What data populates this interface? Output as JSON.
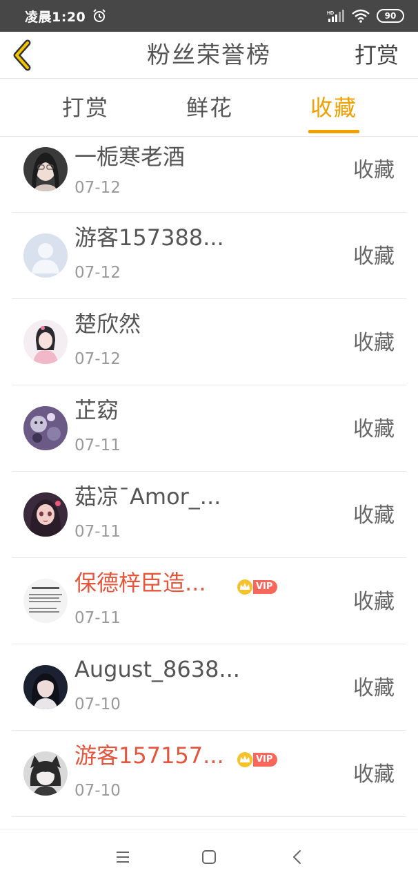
{
  "status_bar": {
    "time": "凌晨1:20",
    "battery": "90",
    "icons": [
      "alarm-icon",
      "hd-signal-icon",
      "wifi-icon",
      "battery-icon"
    ]
  },
  "header": {
    "back_icon": "chevron-left-icon",
    "title": "粉丝荣誉榜",
    "action": "打赏"
  },
  "tabs": [
    {
      "label": "打赏",
      "active": false
    },
    {
      "label": "鲜花",
      "active": false
    },
    {
      "label": "收藏",
      "active": true
    }
  ],
  "colors": {
    "accent": "#f0a000",
    "vip_name": "#e4553b",
    "vip_badge": "#f8675a",
    "status_bar": "#474747"
  },
  "fans": [
    {
      "name": "一栀寒老酒",
      "date": "07-12",
      "action": "收藏",
      "vip": false
    },
    {
      "name": "游客157388...",
      "date": "07-12",
      "action": "收藏",
      "vip": false
    },
    {
      "name": "楚欣然",
      "date": "07-12",
      "action": "收藏",
      "vip": false
    },
    {
      "name": "芷窈",
      "date": "07-11",
      "action": "收藏",
      "vip": false
    },
    {
      "name": "菇凉¯Amor_...",
      "date": "07-11",
      "action": "收藏",
      "vip": false
    },
    {
      "name": "保德梓臣造...",
      "date": "07-11",
      "action": "收藏",
      "vip": true
    },
    {
      "name": "August_8638...",
      "date": "07-10",
      "action": "收藏",
      "vip": false
    },
    {
      "name": "游客157157...",
      "date": "07-10",
      "action": "收藏",
      "vip": true
    }
  ],
  "vip_label": "VIP",
  "nav_bar": {
    "icons": [
      "menu-icon",
      "home-square-icon",
      "back-triangle-icon"
    ]
  }
}
